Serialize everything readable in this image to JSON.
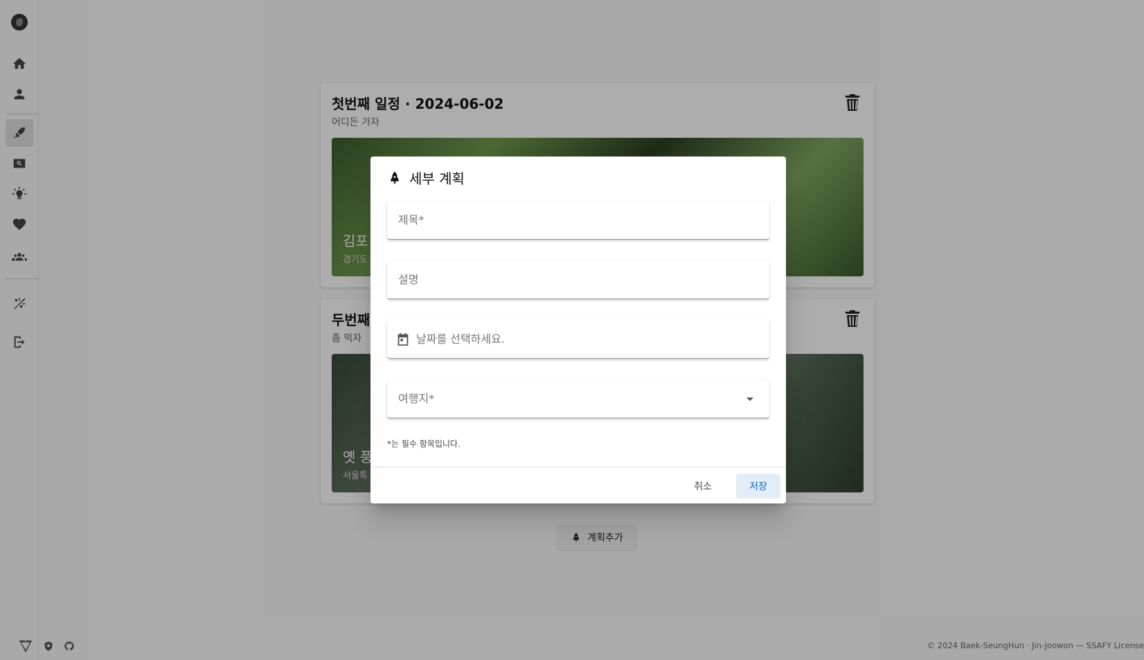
{
  "sidebar": {
    "items": [
      {
        "name": "home-icon"
      },
      {
        "name": "person-icon"
      },
      {
        "name": "rocket-icon",
        "active": true
      },
      {
        "name": "search-icon"
      },
      {
        "name": "lightbulb-icon"
      },
      {
        "name": "heart-icon"
      },
      {
        "name": "group-icon"
      },
      {
        "name": "weather-icon"
      },
      {
        "name": "logout-icon"
      }
    ]
  },
  "plans": [
    {
      "title": "첫번째 일정 · 2024-06-02",
      "subtitle": "어디든 가자",
      "place": "김포",
      "region": "경기도"
    },
    {
      "title": "두번째",
      "subtitle": "좀 먹자",
      "place": "옛 풍",
      "region": "서울특"
    }
  ],
  "add_button": {
    "label": "계획추가"
  },
  "footer": {
    "copyright": "© 2024 Baek-SeungHun · Jin-Joowon — SSAFY License"
  },
  "dialog": {
    "title": "세부 계획",
    "fields": {
      "title_placeholder": "제목*",
      "description_placeholder": "설명",
      "date_placeholder": "날짜를 선택하세요.",
      "destination_placeholder": "여행지*"
    },
    "required_note": "*는 필수 항목입니다.",
    "cancel_label": "취소",
    "save_label": "저장"
  },
  "colors": {
    "accent": "#1565c0",
    "save_bg": "#e3edf8",
    "overlay": "rgba(0,0,0,0.32)"
  }
}
